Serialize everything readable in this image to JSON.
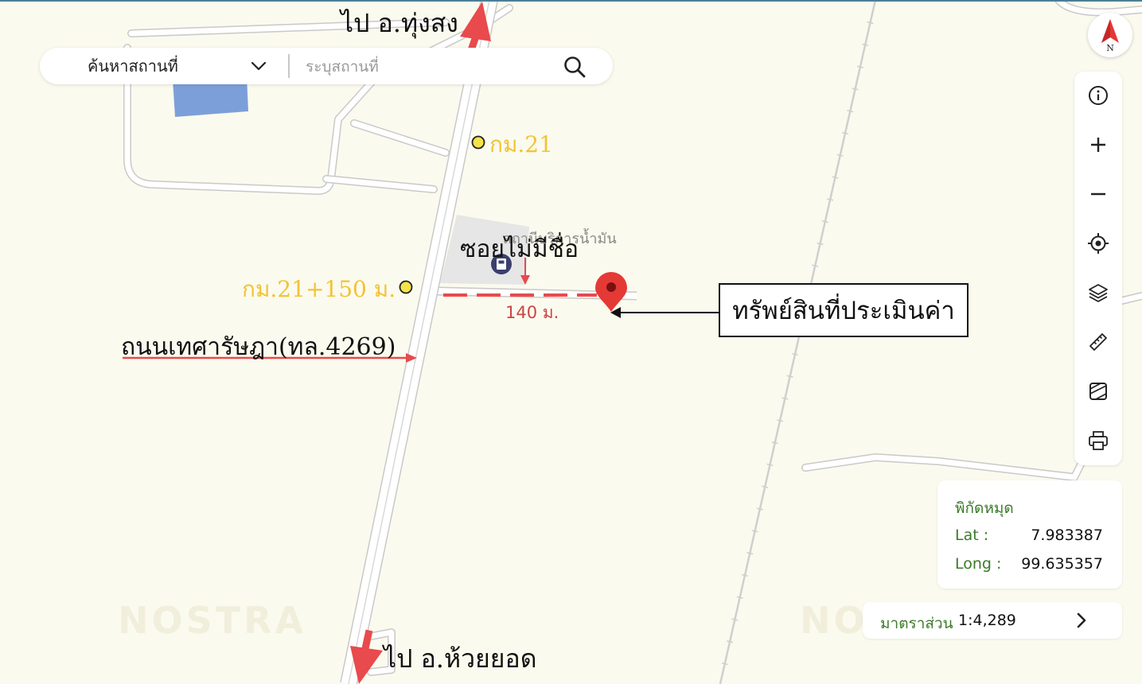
{
  "search": {
    "category": "ค้นหาสถานที่",
    "placeholder": "ระบุสถานที่"
  },
  "map": {
    "watermark": "NOSTRA",
    "poi_label": "สถานีบริการน้ำมัน",
    "distance_label": "140 ม.",
    "annotations": {
      "to_north": "ไป อ.ทุ่งสง",
      "to_south": "ไป อ.ห้วยยอด",
      "km_marker_1": "กม.21",
      "km_marker_2": "กม.21+150 ม.",
      "soi_label": "ซอยไม่มีชื่อ",
      "road_label": "ถนนเทศารัษฎา(ทล.4269)",
      "asset_label": "ทรัพย์สินที่ประเมินค่า"
    },
    "colors": {
      "background": "#fbfaee",
      "road": "#ffffff",
      "road_outline": "#c9c9c9",
      "water": "#7d9fd9",
      "arrow_red": "#e84a4d",
      "km_yellow": "#f2c335",
      "label_green": "#3c7b2a"
    }
  },
  "compass": {
    "label": "N",
    "icon": "compass-north-icon"
  },
  "toolbar": {
    "tools": [
      "info-icon",
      "zoom-in-icon",
      "zoom-out-icon",
      "locate-icon",
      "layers-icon",
      "ruler-icon",
      "map-style-icon",
      "print-icon"
    ]
  },
  "coordinates": {
    "title": "พิกัดหมุด",
    "lat_label": "Lat :",
    "lat_value": "7.983387",
    "long_label": "Long :",
    "long_value": "99.635357"
  },
  "scale": {
    "label": "มาตราส่วน",
    "value": "1:4,289"
  }
}
